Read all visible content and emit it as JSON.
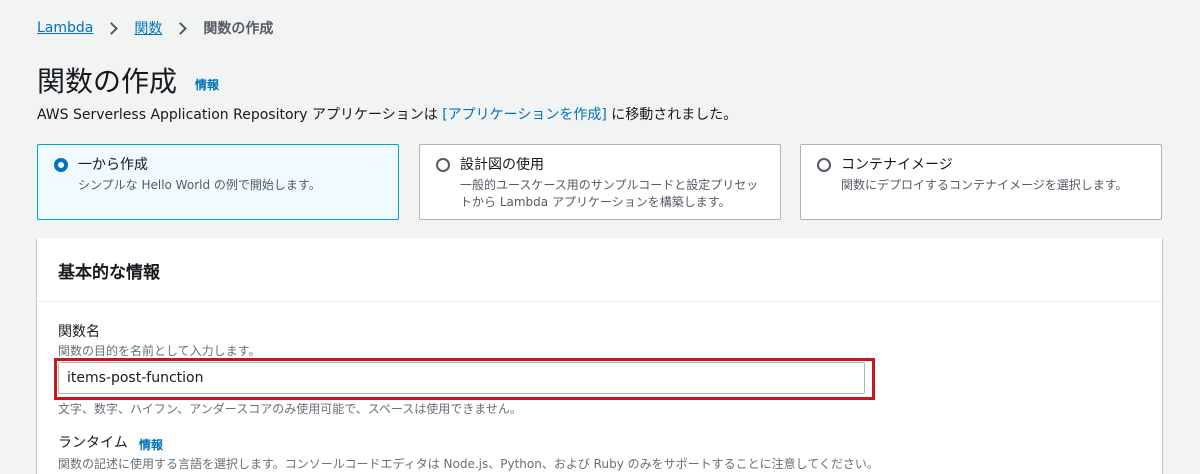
{
  "breadcrumb": {
    "items": [
      "Lambda",
      "関数",
      "関数の作成"
    ]
  },
  "header": {
    "title": "関数の作成",
    "info_link": "情報",
    "notice_prefix": "AWS Serverless Application Repository アプリケーションは ",
    "notice_link": "[アプリケーションを作成]",
    "notice_suffix": " に移動されました。"
  },
  "create_options": [
    {
      "title": "一から作成",
      "description": "シンプルな Hello World の例で開始します。",
      "selected": true
    },
    {
      "title": "設計図の使用",
      "description": "一般的ユースケース用のサンプルコードと設定プリセットから Lambda アプリケーションを構築します。",
      "selected": false
    },
    {
      "title": "コンテナイメージ",
      "description": "関数にデプロイするコンテナイメージを選択します。",
      "selected": false
    }
  ],
  "basic_info": {
    "title": "基本的な情報",
    "function_name": {
      "label": "関数名",
      "description": "関数の目的を名前として入力します。",
      "value": "items-post-function",
      "constraint": "文字、数字、ハイフン、アンダースコアのみ使用可能で、スペースは使用できません。"
    },
    "runtime": {
      "label": "ランタイム",
      "info_link": "情報",
      "description": "関数の記述に使用する言語を選択します。コンソールコードエディタは Node.js、Python、および Ruby のみをサポートすることに注意してください。"
    }
  },
  "colors": {
    "link": "#0073bb",
    "selected_border": "#00a1c9",
    "highlight": "#c7161d"
  }
}
